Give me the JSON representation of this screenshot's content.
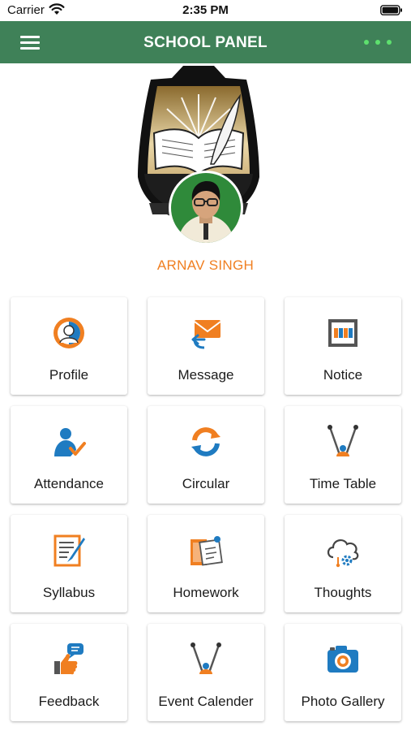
{
  "status_bar": {
    "carrier": "Carrier",
    "time": "2:35 PM"
  },
  "header": {
    "title": "SCHOOL PANEL"
  },
  "student": {
    "name": "ARNAV SINGH"
  },
  "colors": {
    "nav": "#3f8158",
    "accent_orange": "#f07f21",
    "icon_blue": "#1f7bc1",
    "more_dots": "#5ee06e"
  },
  "tiles": [
    {
      "label": "Profile",
      "icon": "profile-icon"
    },
    {
      "label": "Message",
      "icon": "message-icon"
    },
    {
      "label": "Notice",
      "icon": "notice-icon"
    },
    {
      "label": "Attendance",
      "icon": "attendance-icon"
    },
    {
      "label": "Circular",
      "icon": "circular-icon"
    },
    {
      "label": "Time Table",
      "icon": "time-table-icon"
    },
    {
      "label": "Syllabus",
      "icon": "syllabus-icon"
    },
    {
      "label": "Homework",
      "icon": "homework-icon"
    },
    {
      "label": "Thoughts",
      "icon": "thoughts-icon"
    },
    {
      "label": "Feedback",
      "icon": "feedback-icon"
    },
    {
      "label": "Event Calender",
      "icon": "event-calender-icon"
    },
    {
      "label": "Photo Gallery",
      "icon": "photo-gallery-icon"
    }
  ]
}
